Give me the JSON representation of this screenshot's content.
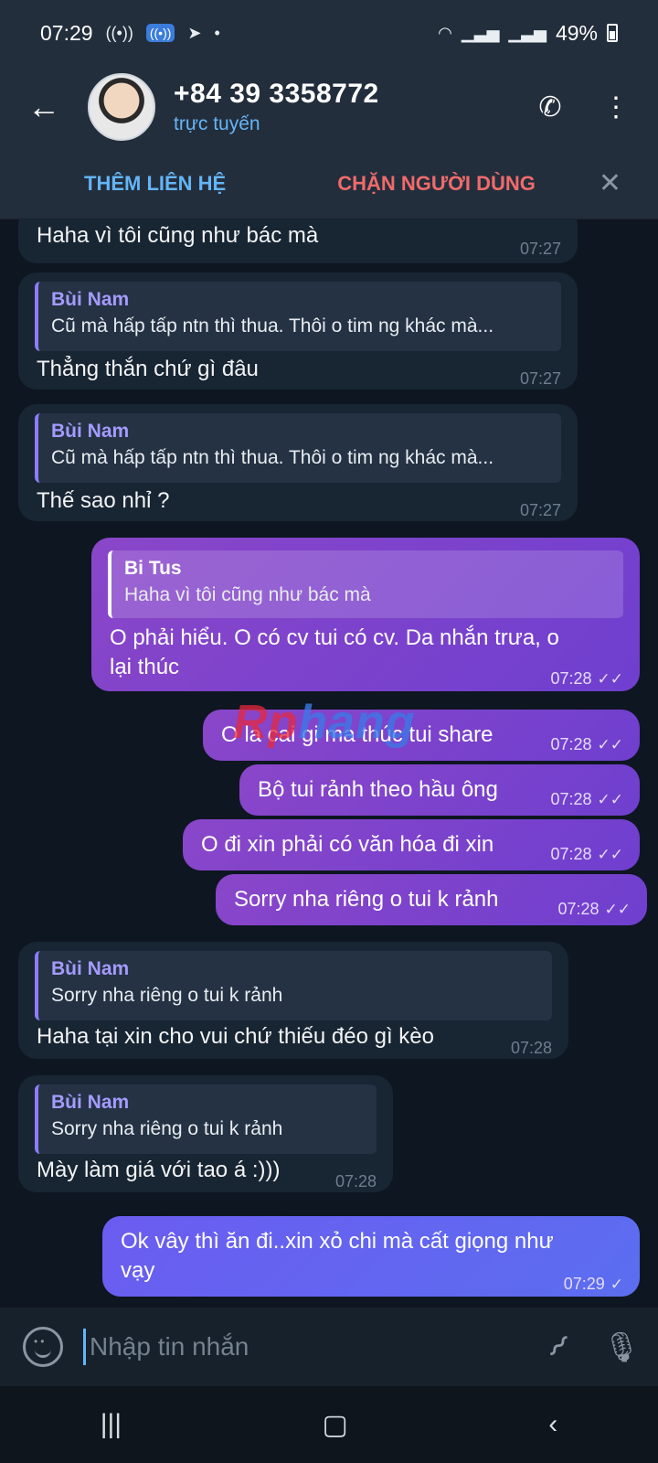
{
  "status_bar": {
    "time": "07:29",
    "battery": "49%"
  },
  "header": {
    "contact_name": "+84 39 3358772",
    "contact_status": "trực tuyến"
  },
  "action_bar": {
    "add_contact": "THÊM LIÊN HỆ",
    "block_user": "CHẶN NGƯỜI DÙNG"
  },
  "watermark": {
    "part1": "Rp",
    "part2": "hang"
  },
  "messages": [
    {
      "text": "Haha vì tôi cũng như bác mà",
      "time": "07:27"
    },
    {
      "reply_name": "Bùi Nam",
      "reply_text": "Cũ mà hấp tấp ntn thì thua. Thôi o tim ng khác mà...",
      "text": "Thẳng thắn chứ gì đâu",
      "time": "07:27"
    },
    {
      "reply_name": "Bùi Nam",
      "reply_text": "Cũ mà hấp tấp ntn thì thua. Thôi o tim ng khác mà...",
      "text": "Thế sao nhỉ ?",
      "time": "07:27"
    },
    {
      "reply_name": "Bi Tus",
      "reply_text": "Haha vì tôi cũng như bác mà",
      "text_line1": "O phải hiểu. O có cv tui có cv. Da nhắn trưa, o",
      "text_line2": "lại thúc",
      "time": "07:28",
      "ticks": "✓✓"
    },
    {
      "text": "O la cai gi ma thúc tui share",
      "time": "07:28",
      "ticks": "✓✓"
    },
    {
      "text": "Bộ tui rảnh theo hầu ông",
      "time": "07:28",
      "ticks": "✓✓"
    },
    {
      "text": "O đi xin phải có văn hóa đi xin",
      "time": "07:28",
      "ticks": "✓✓"
    },
    {
      "text": "Sorry nha riêng o tui k rảnh",
      "time": "07:28",
      "ticks": "✓✓"
    },
    {
      "reply_name": "Bùi Nam",
      "reply_text": "Sorry nha riêng o tui k rảnh",
      "text": "Haha tại xin cho vui chứ thiếu đéo gì kèo",
      "time": "07:28"
    },
    {
      "reply_name": "Bùi Nam",
      "reply_text": "Sorry nha riêng o tui k rảnh",
      "text": "Mày làm giá với tao á :)))",
      "time": "07:28"
    },
    {
      "text_line1": "Ok vây thì ăn đi..xin xỏ chi mà cất giọng như",
      "text_line2": "vạy",
      "time": "07:29",
      "ticks": "✓"
    }
  ],
  "composer": {
    "placeholder": "Nhập tin nhắn"
  },
  "icons": {
    "back": "arrow-left-icon",
    "call": "phone-icon",
    "menu": "more-vertical-icon",
    "close": "close-icon",
    "emoji": "emoji-icon",
    "attach": "paperclip-icon",
    "mic": "microphone-icon"
  }
}
